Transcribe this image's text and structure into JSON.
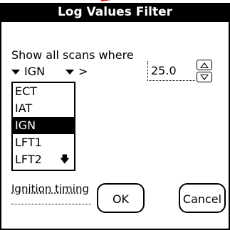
{
  "dialog": {
    "title": "Log Values Filter"
  },
  "filter": {
    "prompt": "Show all scans where",
    "field_selected": "IGN",
    "operator": ">",
    "value": "25.0"
  },
  "field_list": {
    "items": [
      "ECT",
      "IAT",
      "IGN",
      "LFT1",
      "LFT2"
    ],
    "selected": "IGN",
    "scroll_indicator": "down-arrow"
  },
  "description": {
    "text": "Ignition timing"
  },
  "buttons": {
    "ok_label": "OK",
    "cancel_label": "Cancel"
  }
}
